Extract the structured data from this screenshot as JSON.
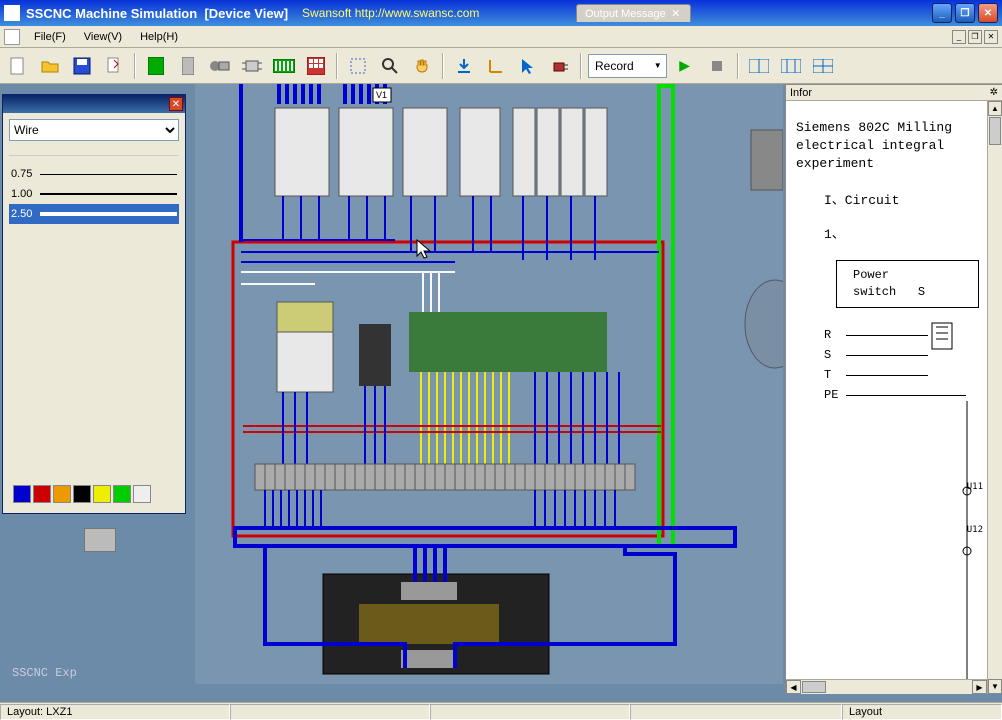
{
  "title": {
    "app": "SSCNC Machine Simulation",
    "sub": "[Device View]",
    "watermark": "Swansoft http://www.swansc.com"
  },
  "tab": {
    "label": "Output Message"
  },
  "menu": {
    "file": "File(F)",
    "view": "View(V)",
    "help": "Help(H)"
  },
  "toolbar": {
    "new": "new-file-icon",
    "open": "open-folder-icon",
    "save": "save-disk-icon",
    "export": "export-icon",
    "panel1": "panel-green-icon",
    "panel2": "panel-gray-icon",
    "device": "device-icon",
    "chip": "chip-icon",
    "dip": "dip-switch-icon",
    "keypad": "keypad-icon",
    "select": "select-rect-icon",
    "zoom": "magnifier-icon",
    "hand": "pan-hand-icon",
    "download": "download-icon",
    "axis": "axis-icon",
    "pointer": "pointer-icon",
    "plug": "plug-icon",
    "record_label": "Record",
    "play": "play-icon",
    "stop": "stop-icon",
    "view1": "view-split-1-icon",
    "view2": "view-split-2-icon",
    "view3": "view-split-3-icon"
  },
  "wire_panel": {
    "dropdown_label": "Wire",
    "sizes": [
      {
        "label": "0.75",
        "thickness": 1,
        "selected": false
      },
      {
        "label": "1.00",
        "thickness": 2,
        "selected": false
      },
      {
        "label": "2.50",
        "thickness": 4,
        "selected": true
      }
    ],
    "colors": [
      "#0000cc",
      "#cc0000",
      "#ee9900",
      "#000000",
      "#eeee00",
      "#00cc00",
      "#eeeeee"
    ]
  },
  "canvas": {
    "tooltip": "V1"
  },
  "info": {
    "header": "Infor",
    "text": "Siemens 802C Milling\nelectrical integral\nexperiment",
    "section1": "I、Circuit",
    "section2": "1、",
    "diagram_label_1": "Power switch",
    "diagram_label_2": "S",
    "rst": [
      "R",
      "S",
      "T",
      "PE"
    ],
    "u_labels": [
      "U11",
      "U12"
    ]
  },
  "status": {
    "left": "Layout: LXZ1",
    "right": "Layout",
    "ghost": "SSCNC Exp"
  }
}
